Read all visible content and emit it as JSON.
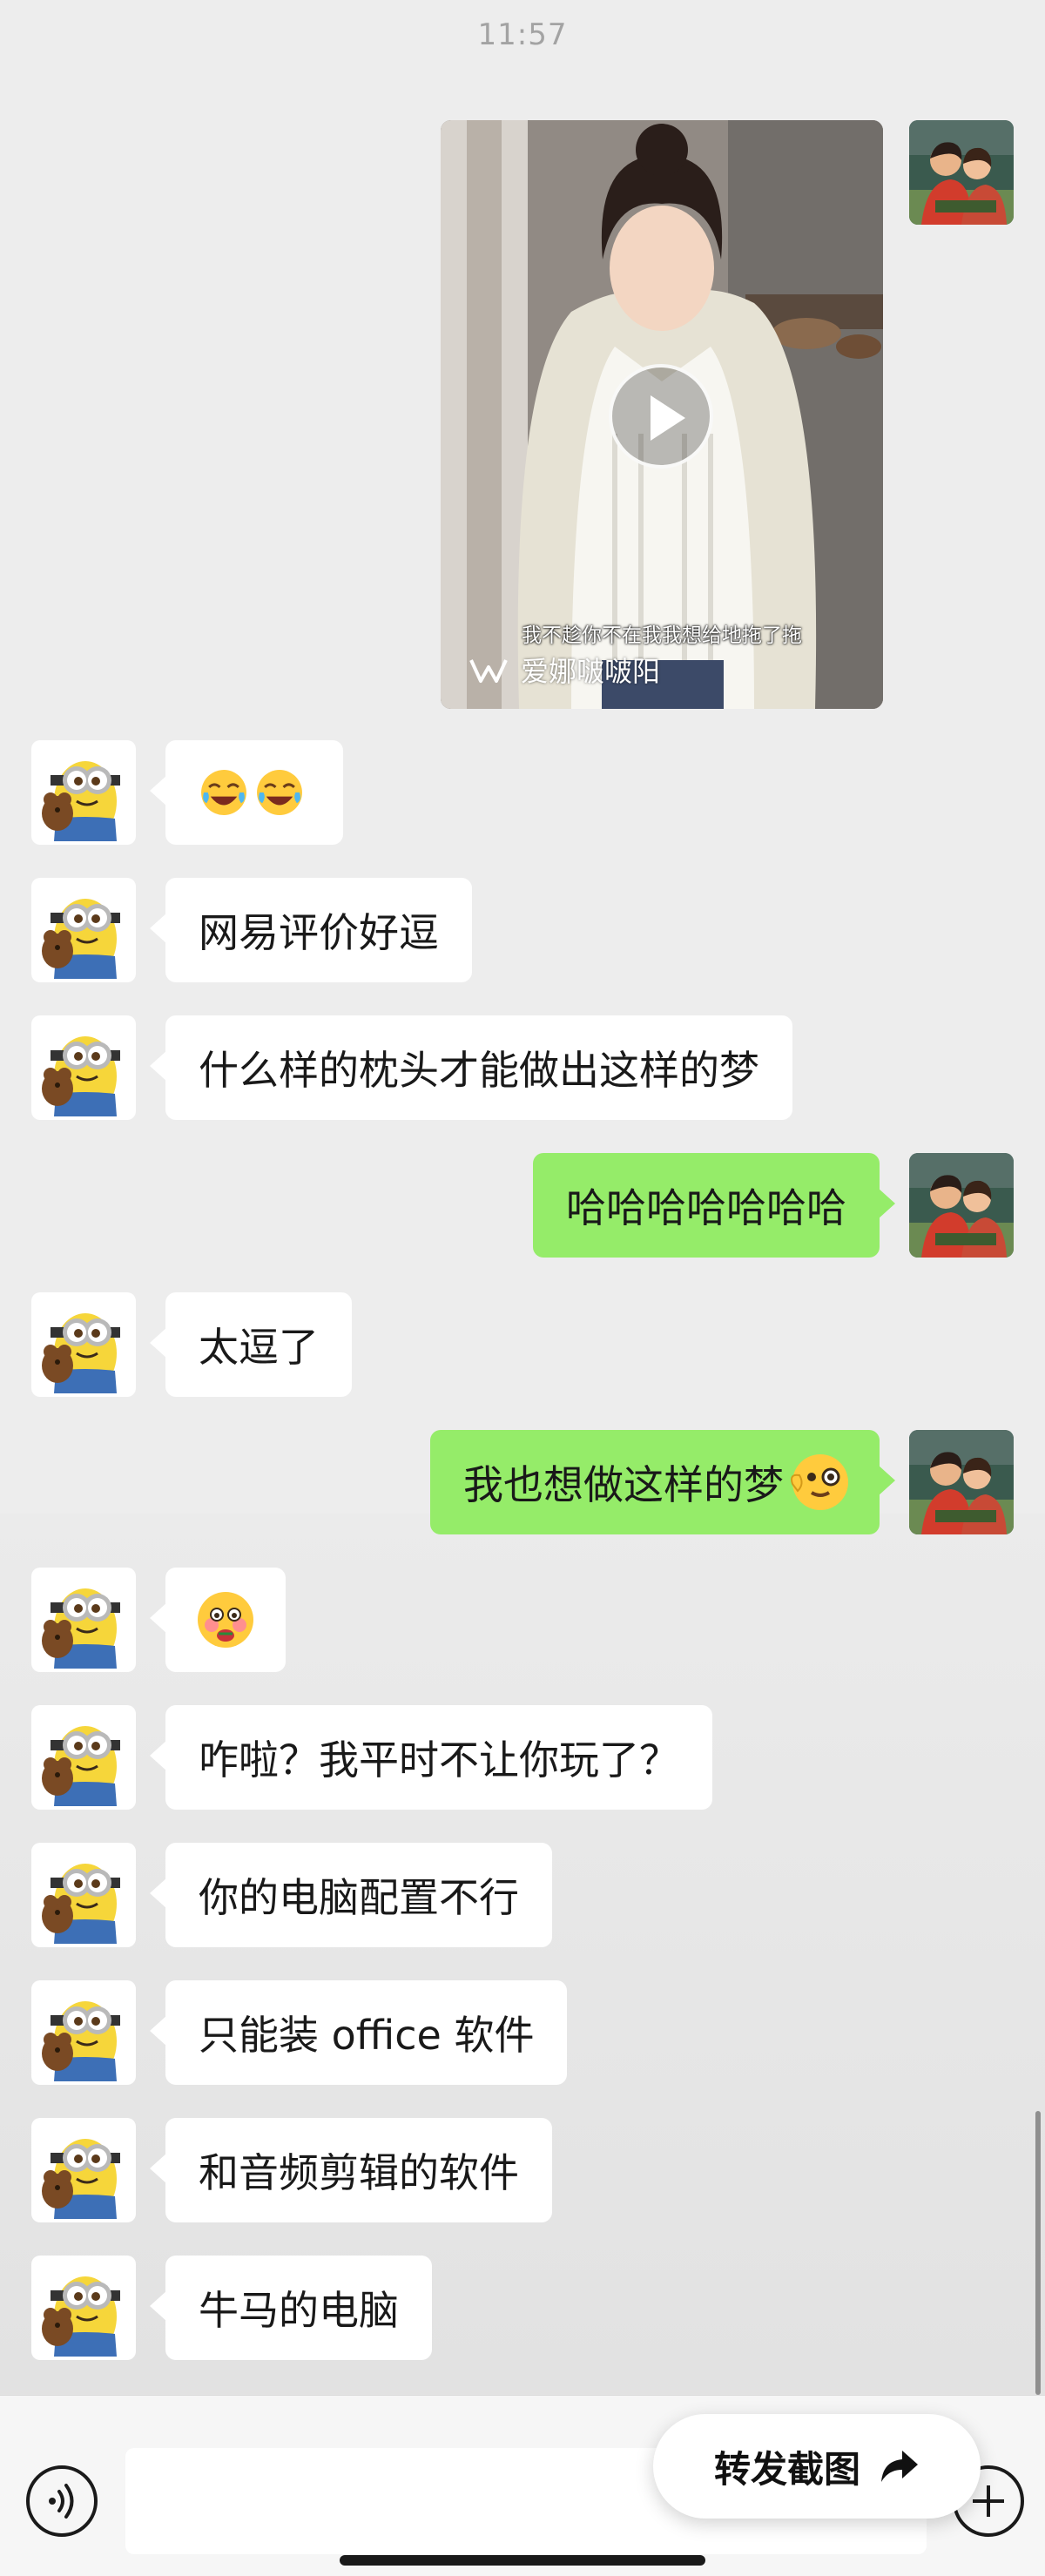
{
  "status": {
    "time": "11:57"
  },
  "video": {
    "subtitle": "我不趁你不在我我想给地拖了拖",
    "watermark": "爱娜啵啵阳",
    "watermark_icon": "app-logo-icon"
  },
  "messages": [
    {
      "side": "in",
      "text": "😂😂",
      "emoji": [
        "tears-of-joy-emoji",
        "tears-of-joy-emoji"
      ]
    },
    {
      "side": "in",
      "text": "网易评价好逗"
    },
    {
      "side": "in",
      "text": "什么样的枕头才能做出这样的梦"
    },
    {
      "side": "out",
      "text": "哈哈哈哈哈哈哈"
    },
    {
      "side": "in",
      "text": "太逗了"
    },
    {
      "side": "out",
      "text": "我也想做这样的梦",
      "emoji_after": "face-holding-back-tears-emoji"
    },
    {
      "side": "in",
      "text": "",
      "emoji": [
        "shy-eating-emoji"
      ]
    },
    {
      "side": "in",
      "text": "咋啦？我平时不让你玩了？"
    },
    {
      "side": "in",
      "text": "你的电脑配置不行"
    },
    {
      "side": "in",
      "text": "只能装 office 软件"
    },
    {
      "side": "in",
      "text": "和音频剪辑的软件"
    },
    {
      "side": "in",
      "text": "牛马的电脑"
    }
  ],
  "bottom": {
    "voice_icon": "voice-icon",
    "plus_icon": "plus-icon",
    "forward_label": "转发截图",
    "forward_icon": "share-arrow-icon"
  },
  "colors": {
    "background": "#ededed",
    "incoming_bubble": "#ffffff",
    "outgoing_bubble": "#95ec69"
  }
}
